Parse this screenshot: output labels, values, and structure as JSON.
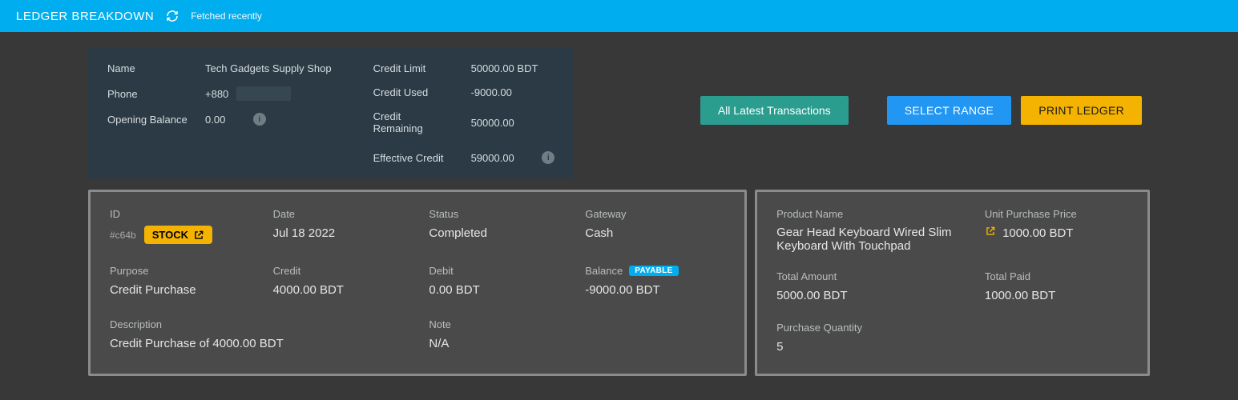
{
  "header": {
    "title": "LEDGER BREAKDOWN",
    "fetched": "Fetched recently"
  },
  "info": {
    "name_label": "Name",
    "name_value": "Tech Gadgets Supply Shop",
    "phone_label": "Phone",
    "phone_prefix": "+880",
    "opening_label": "Opening Balance",
    "opening_value": "0.00",
    "credit_limit_label": "Credit Limit",
    "credit_limit_value": "50000.00 BDT",
    "credit_used_label": "Credit Used",
    "credit_used_value": "-9000.00",
    "credit_remaining_label": "Credit Remaining",
    "credit_remaining_value": "50000.00",
    "effective_label": "Effective Credit",
    "effective_value": "59000.00"
  },
  "actions": {
    "all_latest": "All Latest Transactions",
    "select_range": "SELECT RANGE",
    "print_ledger": "PRINT LEDGER"
  },
  "tx": {
    "id_label": "ID",
    "id_value": "#c64b",
    "stock_badge": "STOCK",
    "date_label": "Date",
    "date_value": "Jul 18 2022",
    "status_label": "Status",
    "status_value": "Completed",
    "gateway_label": "Gateway",
    "gateway_value": "Cash",
    "purpose_label": "Purpose",
    "purpose_value": "Credit Purchase",
    "credit_label": "Credit",
    "credit_value": "4000.00 BDT",
    "debit_label": "Debit",
    "debit_value": "0.00 BDT",
    "balance_label": "Balance",
    "balance_badge": "PAYABLE",
    "balance_value": "-9000.00 BDT",
    "description_label": "Description",
    "description_value": "Credit Purchase of 4000.00 BDT",
    "note_label": "Note",
    "note_value": "N/A"
  },
  "product": {
    "name_label": "Product Name",
    "name_value": "Gear Head Keyboard Wired Slim Keyboard With Touchpad",
    "unit_price_label": "Unit Purchase Price",
    "unit_price_value": "1000.00 BDT",
    "total_amount_label": "Total Amount",
    "total_amount_value": "5000.00 BDT",
    "total_paid_label": "Total Paid",
    "total_paid_value": "1000.00 BDT",
    "qty_label": "Purchase Quantity",
    "qty_value": "5"
  }
}
